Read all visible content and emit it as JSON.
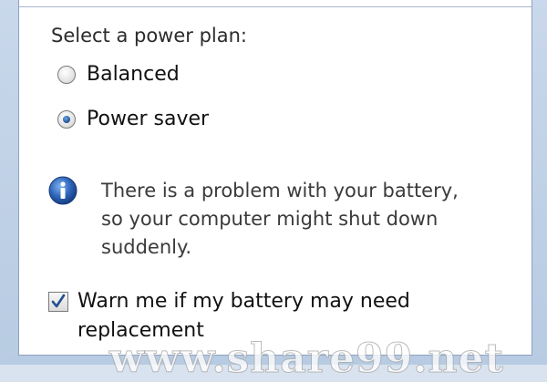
{
  "power_plan": {
    "heading": "Select a power plan:",
    "options": [
      {
        "label": "Balanced",
        "checked": false
      },
      {
        "label": "Power saver",
        "checked": true
      }
    ]
  },
  "info": {
    "icon": "info-icon",
    "lines": [
      "There is a problem with your battery,",
      "so your computer might shut down",
      "suddenly."
    ]
  },
  "warn": {
    "checked": true,
    "label_lines": [
      "Warn me if my battery may need",
      "replacement"
    ]
  },
  "watermark": "www.share99.net",
  "colors": {
    "info_blue": "#2d63b8",
    "radio_dot": "#1f4f8e"
  }
}
